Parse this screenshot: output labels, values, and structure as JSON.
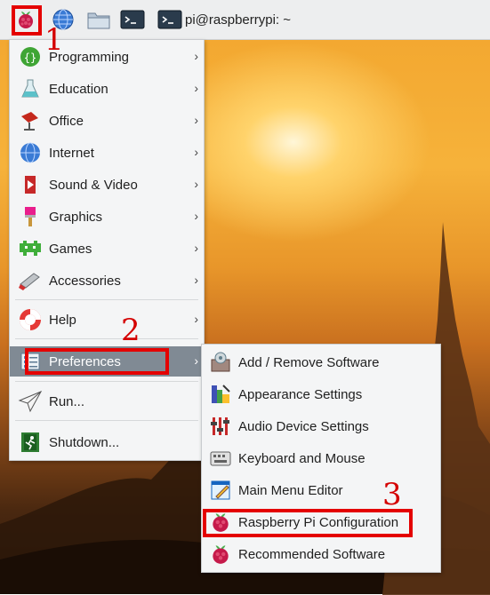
{
  "taskbar": {
    "window_label": "pi@raspberrypi: ~"
  },
  "annotations": {
    "step1": "1",
    "step2": "2",
    "step3": "3"
  },
  "main_menu": {
    "items": [
      {
        "label": "Programming",
        "arrow": "›"
      },
      {
        "label": "Education",
        "arrow": "›"
      },
      {
        "label": "Office",
        "arrow": "›"
      },
      {
        "label": "Internet",
        "arrow": "›"
      },
      {
        "label": "Sound & Video",
        "arrow": "›"
      },
      {
        "label": "Graphics",
        "arrow": "›"
      },
      {
        "label": "Games",
        "arrow": "›"
      },
      {
        "label": "Accessories",
        "arrow": "›"
      },
      {
        "label": "Help",
        "arrow": "›"
      },
      {
        "label": "Preferences",
        "arrow": "›"
      },
      {
        "label": "Run..."
      },
      {
        "label": "Shutdown..."
      }
    ],
    "selected": "Preferences"
  },
  "submenu": {
    "items": [
      {
        "label": "Add / Remove Software"
      },
      {
        "label": "Appearance Settings"
      },
      {
        "label": "Audio Device Settings"
      },
      {
        "label": "Keyboard and Mouse"
      },
      {
        "label": "Main Menu Editor"
      },
      {
        "label": "Raspberry Pi Configuration"
      },
      {
        "label": "Recommended Software"
      }
    ]
  },
  "colors": {
    "highlight": "#e40000",
    "selected_row": "#808a94"
  }
}
